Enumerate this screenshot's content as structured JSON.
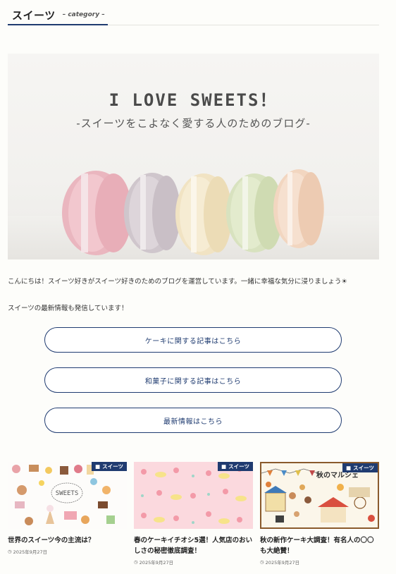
{
  "category": {
    "title": "スイーツ",
    "subtitle": "– category –"
  },
  "hero": {
    "title": "I LOVE SWEETS！",
    "subtitle": "-スイーツをこよなく愛する人のためのブログ-"
  },
  "intro": {
    "line1": "こんにちは！スイーツ好きがスイーツ好きのためのブログを運営しています。一緒に幸福な気分に浸りましょう☀",
    "line2": "スイーツの最新情報も発信しています！"
  },
  "buttons": [
    {
      "label": "ケーキに関する記事はこちら"
    },
    {
      "label": "和菓子に関する記事はこちら"
    },
    {
      "label": "最新情報はこちら"
    }
  ],
  "cards": [
    {
      "badge": "スイーツ",
      "title": "世界のスイーツ今の主流は？",
      "date": "2025年9月27日",
      "thumb_text": "SWEETS"
    },
    {
      "badge": "スイーツ",
      "title": "春のケーキイチオシ5選！人気店のおいしさの秘密徹底調査！",
      "date": "2025年9月27日"
    },
    {
      "badge": "スイーツ",
      "title": "秋の新作ケーキ大調査！有名人の〇〇も大絶賛！",
      "date": "2025年9月27日",
      "thumb_text": "秋のマルシェ"
    }
  ],
  "colors": {
    "accent": "#1f3b70",
    "background": "#fdfdfa"
  }
}
